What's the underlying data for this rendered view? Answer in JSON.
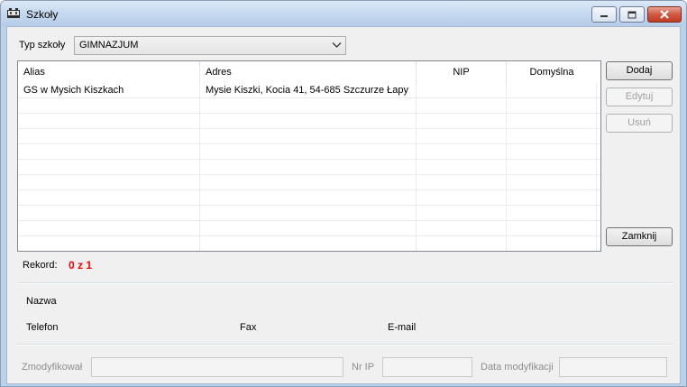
{
  "window": {
    "title": "Szkoły",
    "minimize_label": "minimize",
    "maximize_label": "maximize",
    "close_label": "close"
  },
  "filter": {
    "label": "Typ szkoły",
    "selected": "GIMNAZJUM"
  },
  "grid": {
    "columns": [
      "Alias",
      "Adres",
      "NIP",
      "Domyślna"
    ],
    "rows": [
      {
        "alias": "GS w Mysich Kiszkach",
        "adres": "Mysie Kiszki, Kocia 41, 54-685 Szczurze Łapy",
        "nip": "",
        "domyslna": ""
      }
    ]
  },
  "buttons": {
    "add": "Dodaj",
    "edit": "Edytuj",
    "delete": "Usuń",
    "close": "Zamknij"
  },
  "record": {
    "label": "Rekord:",
    "value": "0 z 1"
  },
  "details": {
    "name_label": "Nazwa",
    "phone_label": "Telefon",
    "fax_label": "Fax",
    "email_label": "E-mail"
  },
  "audit": {
    "modified_by_label": "Zmodyfikował",
    "modified_by_value": "",
    "ip_label": "Nr IP",
    "ip_value": "",
    "date_label": "Data modyfikacji",
    "date_value": ""
  },
  "colors": {
    "record_value": "#ff0000",
    "titlebar": "#c3d7ee",
    "close_button": "#c94a33"
  }
}
